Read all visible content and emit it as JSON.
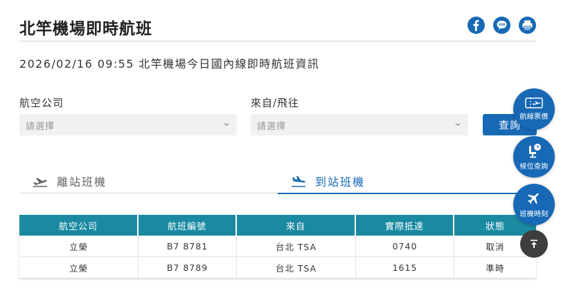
{
  "header": {
    "title": "北竿機場即時航班",
    "share_icons": [
      "facebook-icon",
      "line-icon",
      "print-icon"
    ]
  },
  "subtitle": "2026/02/16 09:55 北竿機場今日國內線即時航班資訊",
  "filters": {
    "airline_label": "航空公司",
    "airline_placeholder": "請選擇",
    "origin_label": "來自/飛往",
    "origin_placeholder": "請選擇",
    "query_label": "查詢"
  },
  "tabs": {
    "departure": "離站班機",
    "arrival": "到站班機",
    "active": "arrival"
  },
  "table": {
    "headers": [
      "航空公司",
      "航班編號",
      "來自",
      "實際抵達",
      "狀態"
    ],
    "rows": [
      [
        "立榮",
        "B7 8781",
        "台北 TSA",
        "0740",
        "取消"
      ],
      [
        "立榮",
        "B7 8789",
        "台北 TSA",
        "1615",
        "準時"
      ]
    ]
  },
  "floating": {
    "fare": "航線票價",
    "standby": "候位查詢",
    "schedule": "班機時刻"
  },
  "colors": {
    "brand_blue": "#1769b5",
    "table_header": "#1a8aa1",
    "back_to_top": "#3e3e3e"
  }
}
